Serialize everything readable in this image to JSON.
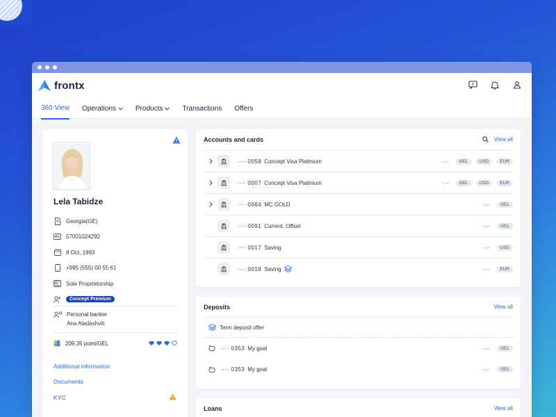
{
  "app": {
    "name": "frontx",
    "nav": [
      {
        "label": "360 View"
      },
      {
        "label": "Operations"
      },
      {
        "label": "Products"
      },
      {
        "label": "Transactions"
      },
      {
        "label": "Offers"
      }
    ]
  },
  "profile": {
    "name": "Lela Tabidze",
    "country": "Georgia(GE)",
    "id_number": "57001024292",
    "birth_date": "8 Oct, 1993",
    "phone": "+995 (555) 00 55 61",
    "business_type": "Sole Proprietorship",
    "segment": "Concept Premium",
    "banker_label": "Personal banker",
    "banker_name": "Ana Aladashvili",
    "points": "209.35 point/GEL",
    "hearts_filled": 3,
    "hearts_total": 4,
    "links": {
      "additional": "Additional information",
      "documents": "Documents",
      "kyc": "KYC"
    }
  },
  "accounts": {
    "title": "Accounts and cards",
    "view_all": "View all",
    "rows": [
      {
        "mask": "···· 0058",
        "name": "Concept Visa Platinium",
        "amount": "-.--",
        "currencies": [
          "GEL",
          "USD",
          "EUR"
        ]
      },
      {
        "mask": "···· 0007",
        "name": "Concept Visa Platinium",
        "amount": "-.--",
        "currencies": [
          "GEL",
          "USD",
          "EUR"
        ]
      },
      {
        "mask": "···· 0064",
        "name": "MC GOLD",
        "amount": "-.--",
        "currencies": [
          "GEL"
        ]
      },
      {
        "mask": "···· 0091",
        "name": "Current, Offset",
        "amount": "-.--",
        "currencies": [
          "GEL"
        ]
      },
      {
        "mask": "···· 0017",
        "name": "Saving",
        "amount": "-.--",
        "currencies": [
          "USD"
        ]
      },
      {
        "mask": "···· 0018",
        "name": "Saving",
        "amount": "-.--",
        "currencies": [
          "EUR"
        ]
      }
    ]
  },
  "deposits": {
    "title": "Deposits",
    "view_all": "View all",
    "offer": "Term deposit offer",
    "rows": [
      {
        "mask": "···· 0353",
        "name": "My goal",
        "amount": "-.--",
        "currency": "GEL"
      },
      {
        "mask": "···· 0353",
        "name": "My goal",
        "amount": "-.--",
        "currency": "GEL"
      }
    ]
  },
  "loans": {
    "title": "Loans",
    "view_all": "View all"
  },
  "colors": {
    "accent": "#2a63e4",
    "tag": "#1b3fb8",
    "warning": "#f0a500"
  }
}
